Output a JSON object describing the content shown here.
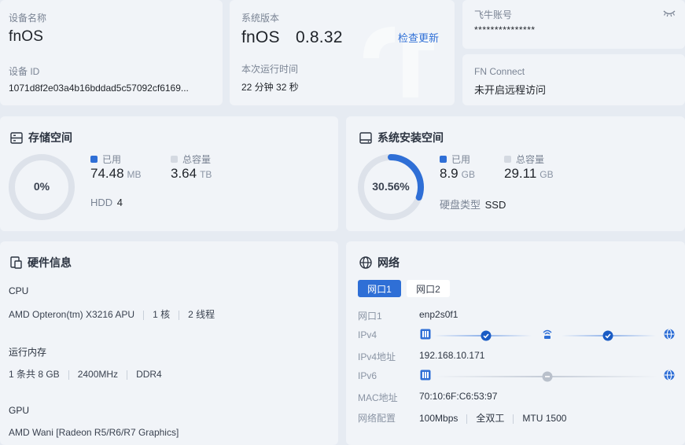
{
  "device": {
    "name_label": "设备名称",
    "name_value": "fnOS",
    "id_label": "设备 ID",
    "id_value": "1071d8f2e03a4b16bddad5c57092cf6169..."
  },
  "system": {
    "version_label": "系统版本",
    "version_name": "fnOS",
    "version_number": "0.8.32",
    "check_update": "检查更新",
    "uptime_label": "本次运行时间",
    "uptime_value": "22 分钟 32 秒"
  },
  "account": {
    "label": "飞牛账号",
    "value": "***************",
    "toggle_icon": "eye-closed-icon"
  },
  "fn_connect": {
    "label": "FN Connect",
    "value": "未开启远程访问"
  },
  "storage": {
    "title": "存储空间",
    "icon": "server-icon",
    "percent_text": "0%",
    "used_fraction": 0.0,
    "used_label": "已用",
    "used_value": "74.48",
    "used_unit": "MB",
    "total_label": "总容量",
    "total_value": "3.64",
    "total_unit": "TB",
    "disk_type": "HDD",
    "disk_count": "4"
  },
  "sys_space": {
    "title": "系统安装空间",
    "icon": "drive-icon",
    "percent_text": "30.56%",
    "used_fraction": 0.3056,
    "used_label": "已用",
    "used_value": "8.9",
    "used_unit": "GB",
    "total_label": "总容量",
    "total_value": "29.11",
    "total_unit": "GB",
    "disk_type_label": "硬盘类型",
    "disk_type_value": "SSD"
  },
  "hardware": {
    "title": "硬件信息",
    "icon": "hardware-icon",
    "cpu_label": "CPU",
    "cpu_model": "AMD Opteron(tm) X3216 APU",
    "cpu_cores": "1 核",
    "cpu_threads": "2 线程",
    "mem_label": "运行内存",
    "mem_count": "1 条共 8 GB",
    "mem_freq": "2400MHz",
    "mem_type": "DDR4",
    "gpu_label": "GPU",
    "gpu_model": "AMD Wani [Radeon R5/R6/R7 Graphics]"
  },
  "network": {
    "title": "网络",
    "icon": "globe-icon",
    "tabs": [
      "网口1",
      "网口2"
    ],
    "port_label": "网口1",
    "port_value": "enp2s0f1",
    "ipv4_label": "IPv4",
    "ipv4_addr_label": "IPv4地址",
    "ipv4_addr_value": "192.168.10.171",
    "ipv6_label": "IPv6",
    "mac_label": "MAC地址",
    "mac_value": "70:10:6F:C6:53:97",
    "config_label": "网络配置",
    "config_speed": "100Mbps",
    "config_duplex": "全双工",
    "config_mtu": "MTU 1500"
  },
  "colors": {
    "accent": "#2f6fd6",
    "ring_track": "#dde2ea",
    "legend_total": "#d4d9e1"
  }
}
